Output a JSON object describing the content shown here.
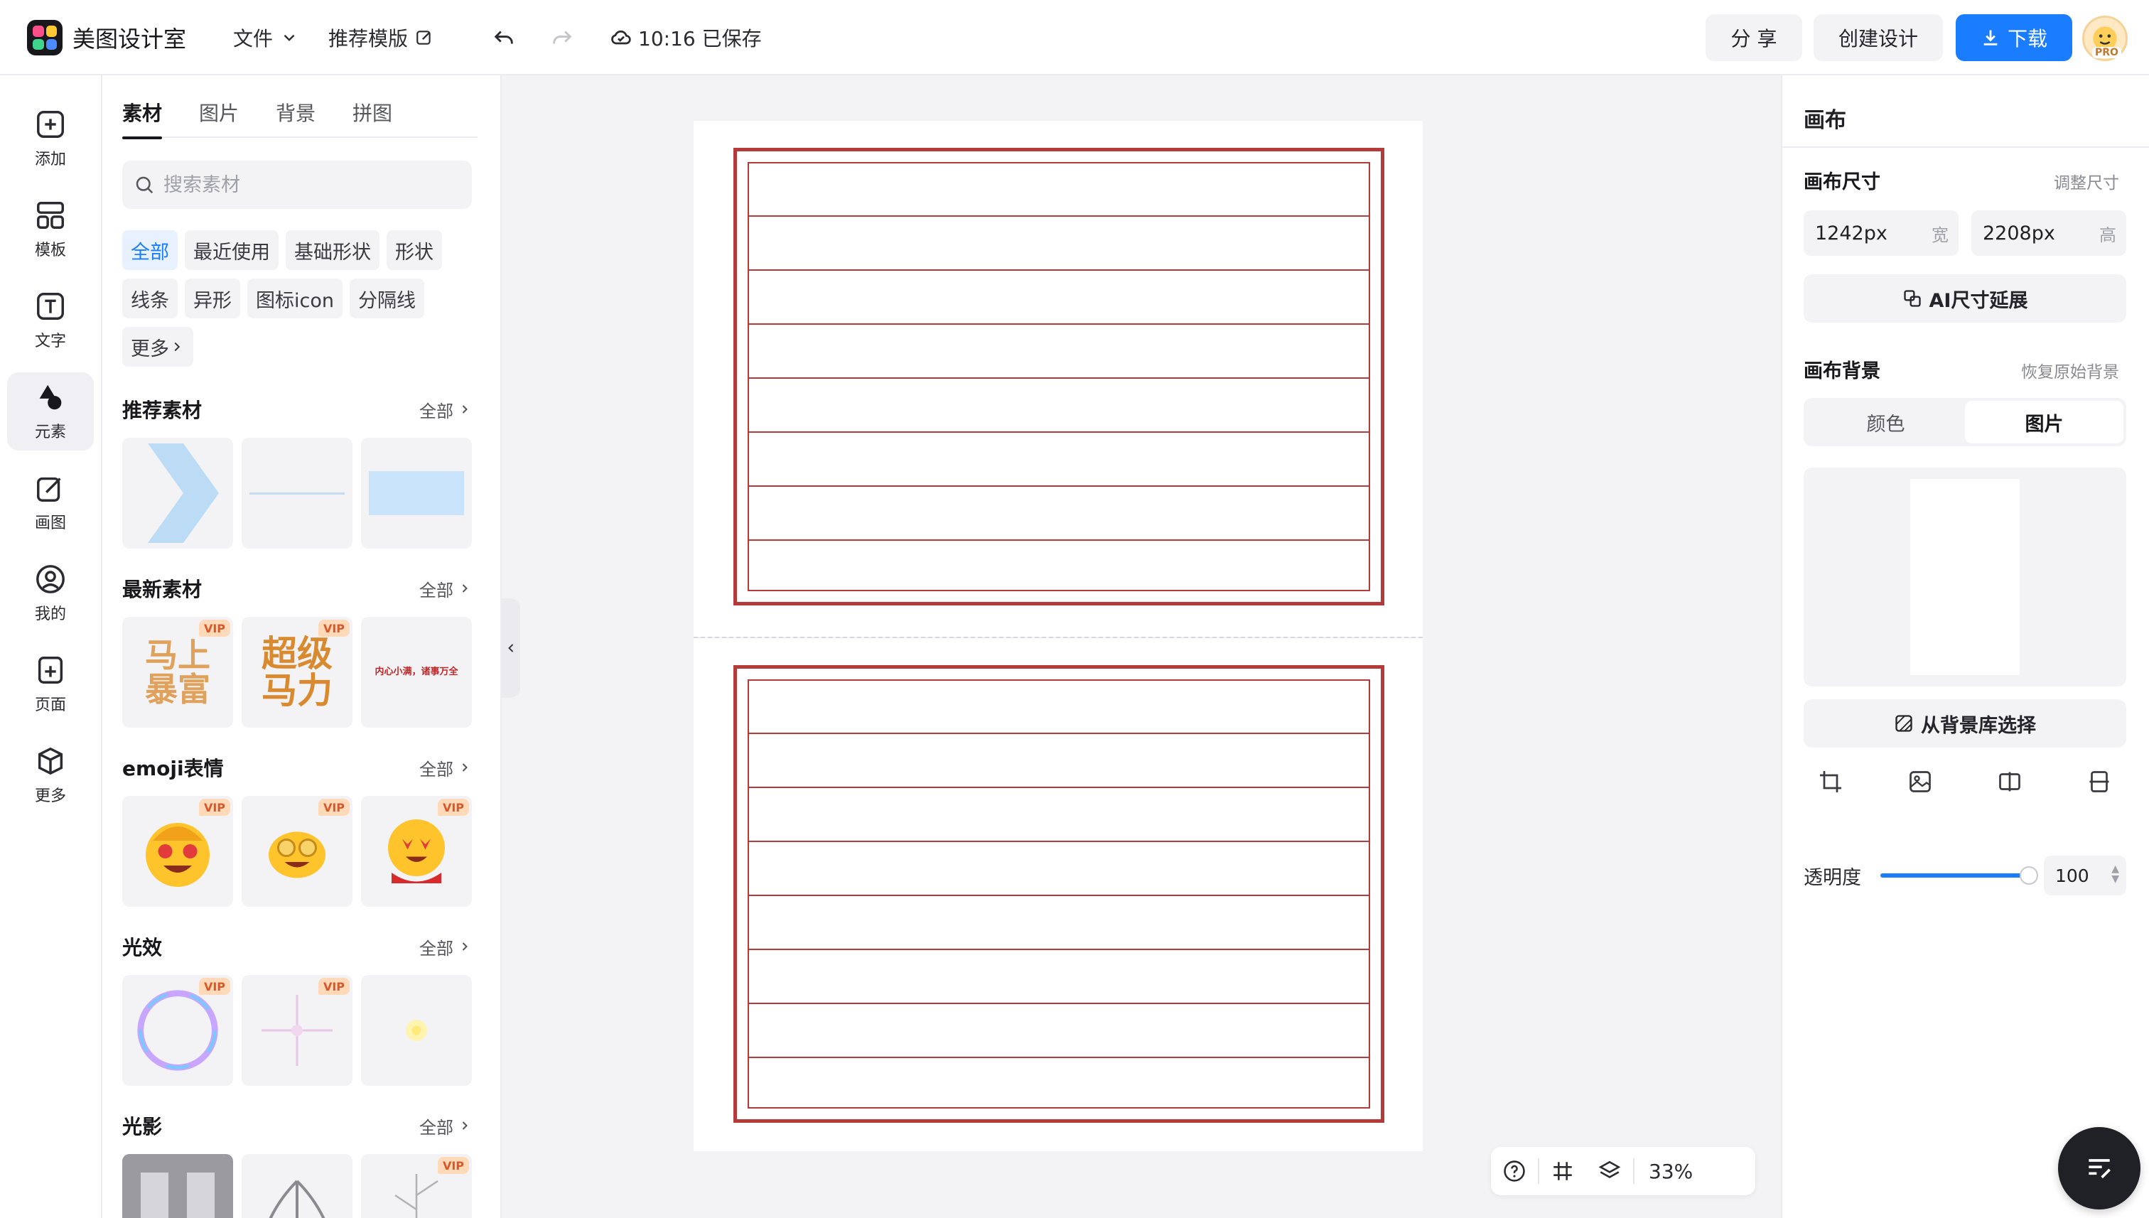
{
  "app": {
    "name": "美图设计室"
  },
  "topbar": {
    "file_label": "文件",
    "template_label": "推荐模版",
    "save_status": "10:16 已保存",
    "share_label": "分 享",
    "create_label": "创建设计",
    "download_label": "下载",
    "pro_badge": "PRO"
  },
  "rail": {
    "items": [
      {
        "label": "添加"
      },
      {
        "label": "模板"
      },
      {
        "label": "文字"
      },
      {
        "label": "元素"
      },
      {
        "label": "画图"
      },
      {
        "label": "我的"
      },
      {
        "label": "页面"
      },
      {
        "label": "更多"
      }
    ]
  },
  "panel": {
    "tabs": [
      "素材",
      "图片",
      "背景",
      "拼图"
    ],
    "search_placeholder": "搜索素材",
    "chips": [
      "全部",
      "最近使用",
      "基础形状",
      "形状",
      "线条",
      "异形",
      "图标icon",
      "分隔线",
      "更多"
    ],
    "more_all": "全部",
    "vip": "VIP",
    "sections": [
      {
        "title": "推荐素材"
      },
      {
        "title": "最新素材",
        "art1": "马上\n暴富",
        "art2": "超级\n马力",
        "art3": "内心小满，诸事万全"
      },
      {
        "title": "emoji表情"
      },
      {
        "title": "光效"
      },
      {
        "title": "光影"
      }
    ]
  },
  "canvas": {
    "zoom": "33%"
  },
  "right": {
    "title": "画布",
    "size_label": "画布尺寸",
    "resize_link": "调整尺寸",
    "width_value": "1242px",
    "width_unit": "宽",
    "height_value": "2208px",
    "height_unit": "高",
    "ai_extend": "AI尺寸延展",
    "bg_label": "画布背景",
    "restore_link": "恢复原始背景",
    "seg_color": "颜色",
    "seg_image": "图片",
    "from_library": "从背景库选择",
    "opacity_label": "透明度",
    "opacity_value": "100"
  },
  "colors": {
    "accent": "#1a7dff",
    "sheet_line": "#b53a3a",
    "vip_bg": "#ffd9b8",
    "vip_text": "#d9582a"
  }
}
